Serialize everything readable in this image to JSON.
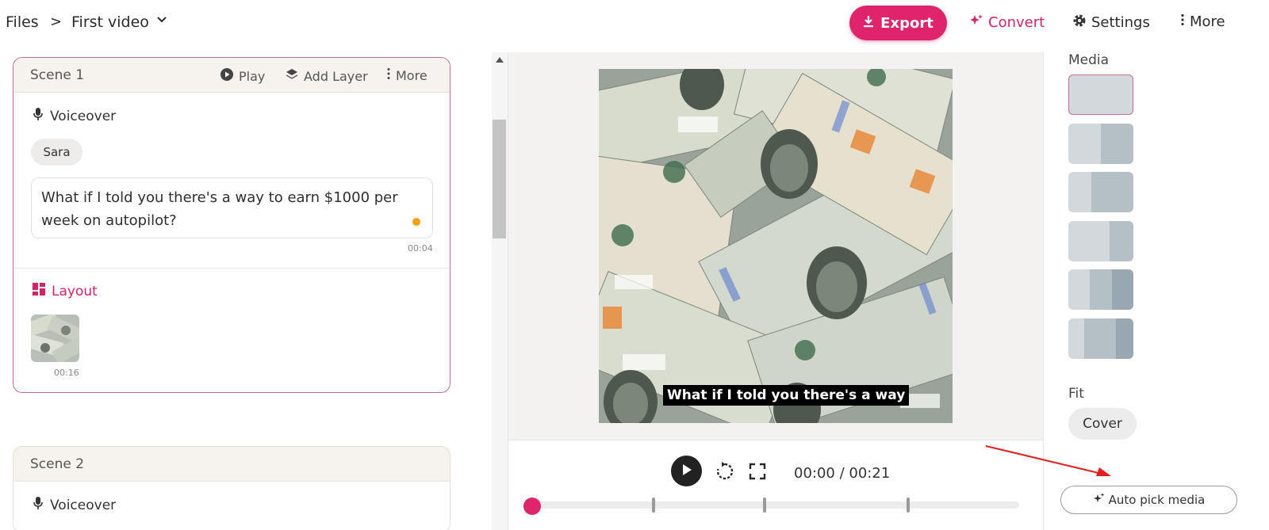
{
  "header": {
    "breadcrumb_root": "Files",
    "breadcrumb_sep": ">",
    "file_name": "First video",
    "export_label": "Export",
    "convert_label": "Convert",
    "settings_label": "Settings",
    "more_label": "More"
  },
  "scenes": [
    {
      "title": "Scene 1",
      "play_label": "Play",
      "add_layer_label": "Add Layer",
      "more_label": "More",
      "voiceover_label": "Voiceover",
      "speaker": "Sara",
      "script": "What if I told you there's a way to earn $1000 per week on autopilot?",
      "script_duration": "00:04",
      "layout_label": "Layout",
      "media_duration": "00:16"
    },
    {
      "title": "Scene 2",
      "voiceover_label": "Voiceover"
    }
  ],
  "preview": {
    "caption": "What if I told you there's a way",
    "timecode": "00:00 / 00:21",
    "progress": 0
  },
  "panel": {
    "media_label": "Media",
    "fit_label": "Fit",
    "fit_value": "Cover",
    "auto_pick_label": "Auto pick media"
  },
  "colors": {
    "accent": "#e0246c",
    "convert_text": "#d0246a",
    "annotation_arrow": "#e0201c"
  }
}
